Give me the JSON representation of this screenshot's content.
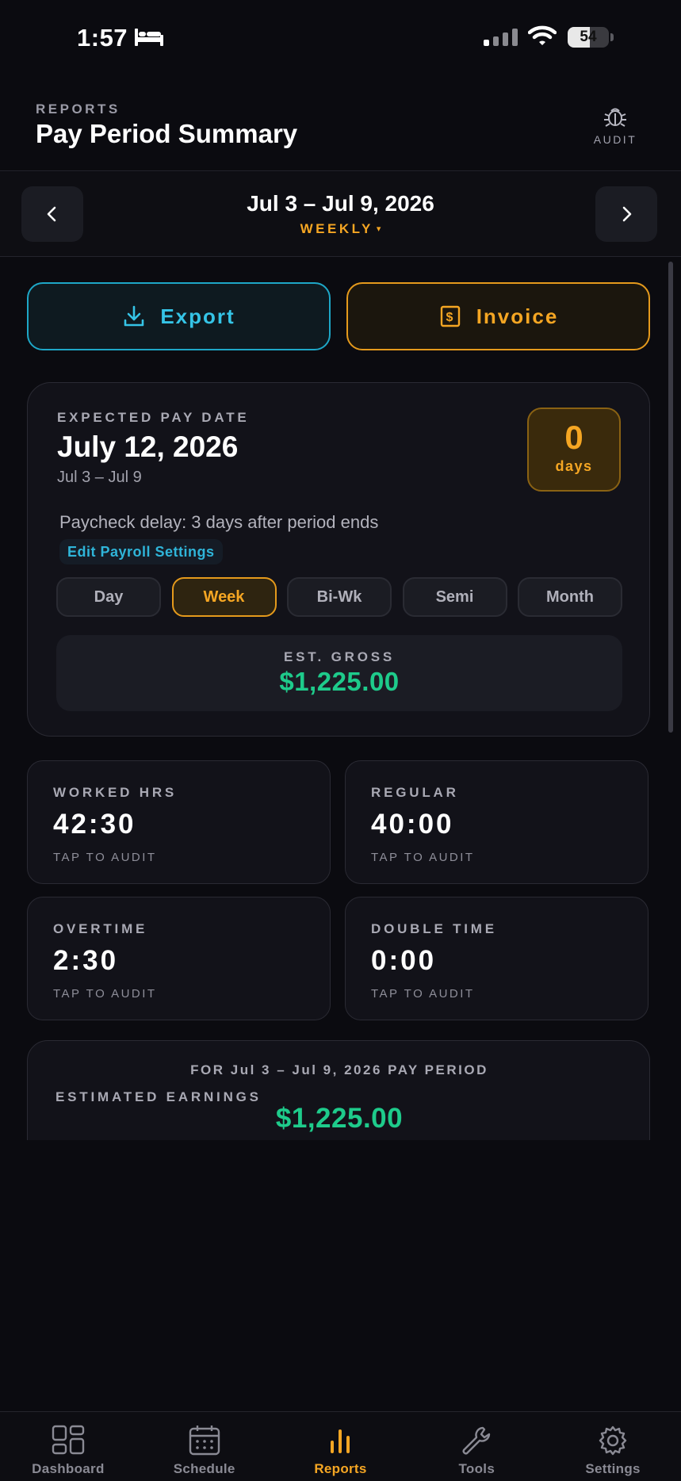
{
  "status_bar": {
    "time": "1:57",
    "battery": "54",
    "battery_level": 0.54
  },
  "header": {
    "eyebrow": "REPORTS",
    "title": "Pay Period Summary",
    "audit_label": "AUDIT"
  },
  "period": {
    "range": "Jul 3 – Jul 9, 2026",
    "mode": "WEEKLY",
    "caret": "▾"
  },
  "actions": {
    "export_label": "Export",
    "invoice_label": "Invoice"
  },
  "pay_card": {
    "label": "EXPECTED PAY DATE",
    "date": "July 12, 2026",
    "range": "Jul 3 – Jul 9",
    "days_value": "0",
    "days_unit": "days",
    "delay_text": "Paycheck delay: 3 days after period ends",
    "edit_label": "Edit Payroll Settings",
    "frequencies": [
      "Day",
      "Week",
      "Bi-Wk",
      "Semi",
      "Month"
    ],
    "selected_frequency": "Week",
    "gross_label": "EST. GROSS",
    "gross_value": "$1,225.00"
  },
  "stats": {
    "worked": {
      "label": "WORKED HRS",
      "value": "42:30",
      "hint": "TAP TO AUDIT"
    },
    "regular": {
      "label": "REGULAR",
      "value": "40:00",
      "hint": "TAP TO AUDIT"
    },
    "overtime": {
      "label": "OVERTIME",
      "value": "2:30",
      "hint": "TAP TO AUDIT"
    },
    "double": {
      "label": "DOUBLE TIME",
      "value": "0:00",
      "hint": "TAP TO AUDIT"
    }
  },
  "earnings": {
    "period_text": "FOR Jul 3 – Jul 9, 2026 PAY PERIOD",
    "label": "ESTIMATED EARNINGS",
    "value": "$1,225.00"
  },
  "tabs": [
    {
      "label": "Dashboard",
      "icon": "grid-icon"
    },
    {
      "label": "Schedule",
      "icon": "calendar-icon"
    },
    {
      "label": "Reports",
      "icon": "bar-chart-icon",
      "active": true
    },
    {
      "label": "Tools",
      "icon": "wrench-icon"
    },
    {
      "label": "Settings",
      "icon": "gear-icon"
    }
  ],
  "colors": {
    "accent_orange": "#f5a623",
    "accent_cyan": "#35c4e6",
    "accent_green": "#1ecb8b",
    "background": "#0b0b10"
  }
}
